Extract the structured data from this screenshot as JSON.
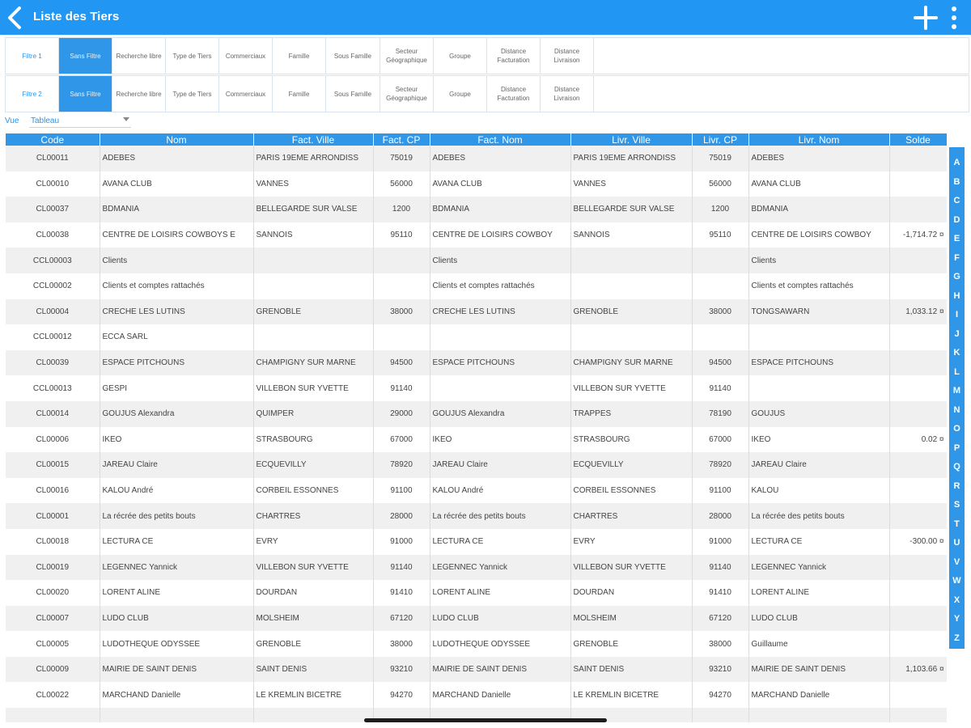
{
  "header": {
    "title": "Liste des Tiers",
    "back_icon": "chevron-left-icon",
    "add_icon": "plus-icon",
    "menu_icon": "more-vertical-icon",
    "brand_color": "#2196f3"
  },
  "filter1": {
    "label": "Filtre 1",
    "items": [
      "Sans Filtre",
      "Recherche libre",
      "Type de Tiers",
      "Commerciaux",
      "Famille",
      "Sous Famille",
      "Secteur Géographique",
      "Groupe",
      "Distance Facturation",
      "Distance Livraison"
    ]
  },
  "filter2": {
    "label": "Filtre 2",
    "items": [
      "Sans Filtre",
      "Recherche libre",
      "Type de Tiers",
      "Commerciaux",
      "Famille",
      "Sous Famille",
      "Secteur Géographique",
      "Groupe",
      "Distance Facturation",
      "Distance Livraison"
    ]
  },
  "vue": {
    "label": "Vue",
    "value": "Tableau"
  },
  "table": {
    "columns": [
      "Code",
      "Nom",
      "Fact. Ville",
      "Fact. CP",
      "Fact. Nom",
      "Livr. Ville",
      "Livr. CP",
      "Livr. Nom",
      "Solde"
    ],
    "rows": [
      [
        "CL00011",
        "ADEBES",
        "PARIS 19EME ARRONDISS",
        "75019",
        "ADEBES",
        "PARIS 19EME ARRONDISS",
        "75019",
        "ADEBES",
        ""
      ],
      [
        "CL00010",
        "AVANA CLUB",
        "VANNES",
        "56000",
        "AVANA CLUB",
        "VANNES",
        "56000",
        "AVANA CLUB",
        ""
      ],
      [
        "CL00037",
        "BDMANIA",
        "BELLEGARDE SUR VALSE",
        "1200",
        "BDMANIA",
        "BELLEGARDE SUR VALSE",
        "1200",
        "BDMANIA",
        ""
      ],
      [
        "CL00038",
        "CENTRE DE LOISIRS COWBOYS E",
        "SANNOIS",
        "95110",
        "CENTRE DE LOISIRS COWBOY",
        "SANNOIS",
        "95110",
        "CENTRE DE LOISIRS COWBOY",
        "-1,714.72 ¤"
      ],
      [
        "CCL00003",
        "Clients",
        "",
        "",
        "Clients",
        "",
        "",
        "Clients",
        ""
      ],
      [
        "CCL00002",
        "Clients et comptes rattachés",
        "",
        "",
        "Clients et comptes rattachés",
        "",
        "",
        "Clients et comptes rattachés",
        ""
      ],
      [
        "CL00004",
        "CRECHE LES LUTINS",
        "GRENOBLE",
        "38000",
        "CRECHE LES LUTINS",
        "GRENOBLE",
        "38000",
        "TONGSAWARN",
        "1,033.12 ¤"
      ],
      [
        "CCL00012",
        "ECCA SARL",
        "",
        "",
        "",
        "",
        "",
        "",
        ""
      ],
      [
        "CL00039",
        "ESPACE PITCHOUNS",
        "CHAMPIGNY SUR MARNE",
        "94500",
        "ESPACE PITCHOUNS",
        "CHAMPIGNY SUR MARNE",
        "94500",
        "ESPACE PITCHOUNS",
        ""
      ],
      [
        "CCL00013",
        "GESPI",
        "VILLEBON SUR YVETTE",
        "91140",
        "",
        "VILLEBON SUR YVETTE",
        "91140",
        "",
        ""
      ],
      [
        "CL00014",
        "GOUJUS Alexandra",
        "QUIMPER",
        "29000",
        "GOUJUS Alexandra",
        "TRAPPES",
        "78190",
        "GOUJUS",
        ""
      ],
      [
        "CL00006",
        "IKEO",
        "STRASBOURG",
        "67000",
        "IKEO",
        "STRASBOURG",
        "67000",
        "IKEO",
        "0.02 ¤"
      ],
      [
        "CL00015",
        "JAREAU Claire",
        "ECQUEVILLY",
        "78920",
        "JAREAU Claire",
        "ECQUEVILLY",
        "78920",
        "JAREAU Claire",
        ""
      ],
      [
        "CL00016",
        "KALOU André",
        "CORBEIL ESSONNES",
        "91100",
        "KALOU André",
        "CORBEIL ESSONNES",
        "91100",
        "KALOU",
        ""
      ],
      [
        "CL00001",
        "La récrée des petits bouts",
        "CHARTRES",
        "28000",
        "La récrée des petits bouts",
        "CHARTRES",
        "28000",
        "La récrée des petits bouts",
        ""
      ],
      [
        "CL00018",
        "LECTURA CE",
        "EVRY",
        "91000",
        "LECTURA CE",
        "EVRY",
        "91000",
        "LECTURA CE",
        "-300.00 ¤"
      ],
      [
        "CL00019",
        "LEGENNEC Yannick",
        "VILLEBON SUR YVETTE",
        "91140",
        "LEGENNEC Yannick",
        "VILLEBON SUR YVETTE",
        "91140",
        "LEGENNEC Yannick",
        ""
      ],
      [
        "CL00020",
        "LORENT ALINE",
        "DOURDAN",
        "91410",
        "LORENT ALINE",
        "DOURDAN",
        "91410",
        "LORENT ALINE",
        ""
      ],
      [
        "CL00007",
        "LUDO CLUB",
        "MOLSHEIM",
        "67120",
        "LUDO CLUB",
        "MOLSHEIM",
        "67120",
        "LUDO CLUB",
        ""
      ],
      [
        "CL00005",
        "LUDOTHEQUE ODYSSEE",
        "GRENOBLE",
        "38000",
        "LUDOTHEQUE ODYSSEE",
        "GRENOBLE",
        "38000",
        "Guillaume",
        ""
      ],
      [
        "CL00009",
        "MAIRIE DE SAINT DENIS",
        "SAINT DENIS",
        "93210",
        "MAIRIE DE SAINT DENIS",
        "SAINT DENIS",
        "93210",
        "MAIRIE DE SAINT DENIS",
        "1,103.66 ¤"
      ],
      [
        "CL00022",
        "MARCHAND Danielle",
        "LE KREMLIN BICETRE",
        "94270",
        "MARCHAND Danielle",
        "LE KREMLIN BICETRE",
        "94270",
        "MARCHAND Danielle",
        ""
      ],
      [
        "",
        "",
        "",
        "",
        "",
        "",
        "",
        "",
        ""
      ]
    ]
  },
  "alphabet": [
    "A",
    "B",
    "C",
    "D",
    "E",
    "F",
    "G",
    "H",
    "I",
    "J",
    "K",
    "L",
    "M",
    "N",
    "O",
    "P",
    "Q",
    "R",
    "S",
    "T",
    "U",
    "V",
    "W",
    "X",
    "Y",
    "Z"
  ]
}
